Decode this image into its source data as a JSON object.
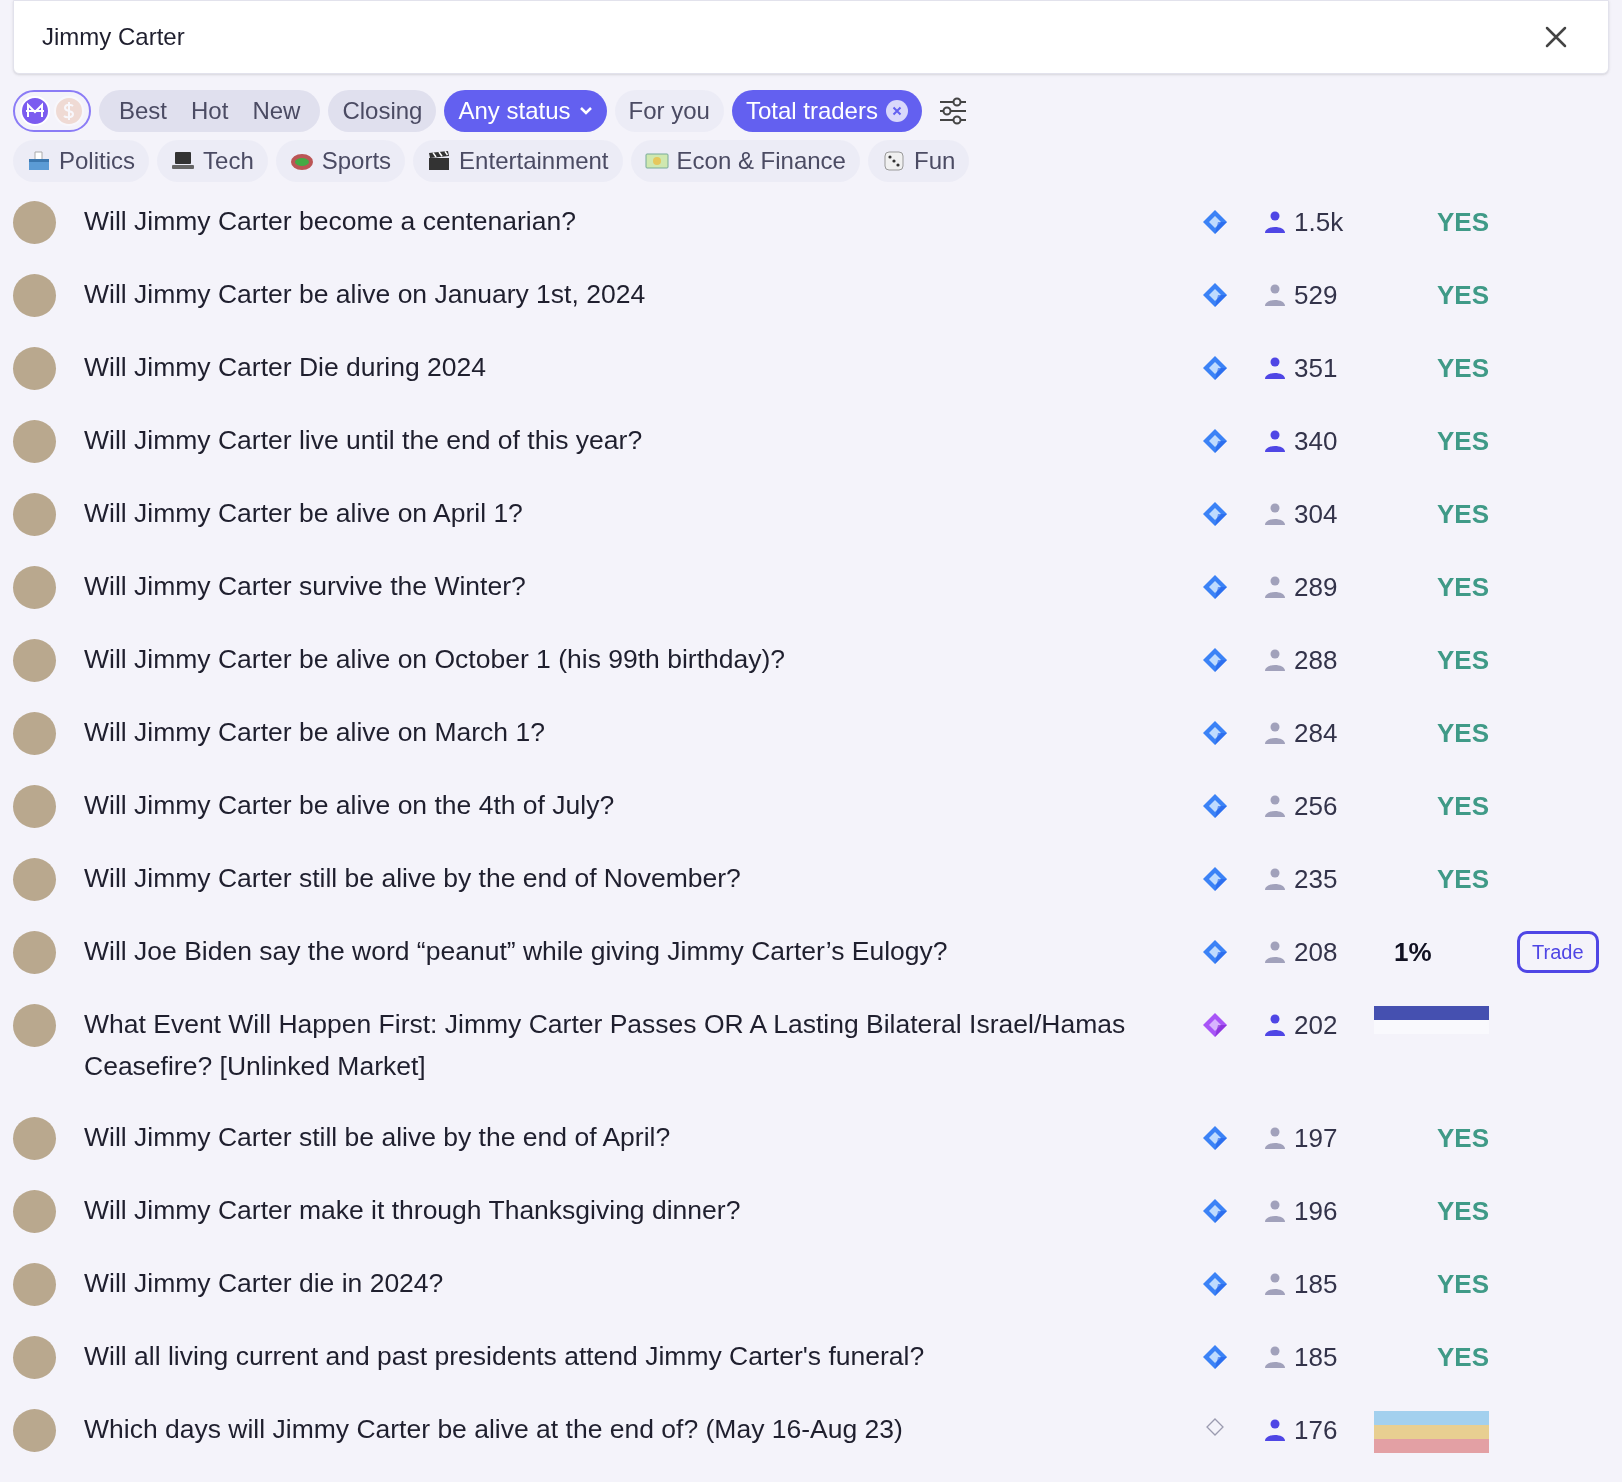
{
  "search": {
    "value": "Jimmy Carter"
  },
  "currency": [
    {
      "kind": "mana",
      "selected": true
    },
    {
      "kind": "cash",
      "selected": false
    }
  ],
  "filters": [
    {
      "kind": "group",
      "items": [
        "Best",
        "Hot",
        "New"
      ]
    },
    {
      "kind": "chip",
      "label": "Closing",
      "selected": false
    },
    {
      "kind": "dropdown",
      "label": "Any status",
      "selected": true
    },
    {
      "kind": "chip",
      "label": "For you",
      "selected": false
    },
    {
      "kind": "removable",
      "label": "Total traders",
      "selected": true
    }
  ],
  "topics": [
    {
      "kind": "ballot",
      "label": "Politics"
    },
    {
      "kind": "laptop",
      "label": "Tech"
    },
    {
      "kind": "stadium",
      "label": "Sports"
    },
    {
      "kind": "clapper",
      "label": "Entertainment"
    },
    {
      "kind": "money",
      "label": "Econ & Finance"
    },
    {
      "kind": "dice",
      "label": "Fun"
    }
  ],
  "markets": [
    {
      "question": "Will Jimmy Carter become a centenarian?",
      "badge": {
        "kind": "plus"
      },
      "traders_highlighted": true,
      "traders": "1.5k",
      "outcome": {
        "kind": "resolved",
        "text": "YES"
      }
    },
    {
      "question": "Will Jimmy Carter be alive on January 1st, 2024",
      "badge": {
        "kind": "plus"
      },
      "traders_highlighted": false,
      "traders": "529",
      "outcome": {
        "kind": "resolved",
        "text": "YES"
      }
    },
    {
      "question": "Will Jimmy Carter Die during 2024",
      "badge": {
        "kind": "plus"
      },
      "traders_highlighted": true,
      "traders": "351",
      "outcome": {
        "kind": "resolved",
        "text": "YES"
      }
    },
    {
      "question": "Will Jimmy Carter live until the end of this year?",
      "badge": {
        "kind": "plus"
      },
      "traders_highlighted": true,
      "traders": "340",
      "outcome": {
        "kind": "resolved",
        "text": "YES"
      }
    },
    {
      "question": "Will Jimmy Carter be alive on April 1?",
      "badge": {
        "kind": "plus"
      },
      "traders_highlighted": false,
      "traders": "304",
      "outcome": {
        "kind": "resolved",
        "text": "YES"
      }
    },
    {
      "question": "Will Jimmy Carter survive the Winter?",
      "badge": {
        "kind": "plus"
      },
      "traders_highlighted": false,
      "traders": "289",
      "outcome": {
        "kind": "resolved",
        "text": "YES"
      }
    },
    {
      "question": "Will Jimmy Carter be alive on October 1 (his 99th birthday)?",
      "badge": {
        "kind": "plus"
      },
      "traders_highlighted": false,
      "traders": "288",
      "outcome": {
        "kind": "resolved",
        "text": "YES"
      }
    },
    {
      "question": "Will Jimmy Carter be alive on March 1?",
      "badge": {
        "kind": "plus"
      },
      "traders_highlighted": false,
      "traders": "284",
      "outcome": {
        "kind": "resolved",
        "text": "YES"
      }
    },
    {
      "question": "Will Jimmy Carter be alive on the 4th of July?",
      "badge": {
        "kind": "plus"
      },
      "traders_highlighted": false,
      "traders": "256",
      "outcome": {
        "kind": "resolved",
        "text": "YES"
      }
    },
    {
      "question": "Will Jimmy Carter still be alive by the end of November?",
      "badge": {
        "kind": "plus"
      },
      "traders_highlighted": false,
      "traders": "235",
      "outcome": {
        "kind": "resolved",
        "text": "YES"
      }
    },
    {
      "question": "Will Joe Biden say the word “peanut” while giving Jimmy Carter’s Eulogy?",
      "badge": {
        "kind": "plus"
      },
      "traders_highlighted": false,
      "traders": "208",
      "outcome": {
        "kind": "probability",
        "text": "1%"
      },
      "trade_button": "Trade"
    },
    {
      "question": "What Event Will Happen First: Jimmy Carter Passes OR A Lasting Bilateral Israel/Hamas Ceasefire? [Unlinked Market]",
      "badge": {
        "kind": "premium"
      },
      "traders_highlighted": true,
      "traders": "202",
      "outcome": {
        "kind": "bars",
        "bars": [
          {
            "color": "#4550b0"
          },
          {
            "color": "#f9f9fd"
          }
        ]
      }
    },
    {
      "question": "Will Jimmy Carter still be alive by the end of April?",
      "badge": {
        "kind": "plus"
      },
      "traders_highlighted": false,
      "traders": "197",
      "outcome": {
        "kind": "resolved",
        "text": "YES"
      }
    },
    {
      "question": "Will Jimmy Carter make it through Thanksgiving dinner?",
      "badge": {
        "kind": "plus"
      },
      "traders_highlighted": false,
      "traders": "196",
      "outcome": {
        "kind": "resolved",
        "text": "YES"
      }
    },
    {
      "question": "Will Jimmy Carter die in 2024?",
      "badge": {
        "kind": "plus"
      },
      "traders_highlighted": false,
      "traders": "185",
      "outcome": {
        "kind": "resolved",
        "text": "YES"
      }
    },
    {
      "question": "Will all living current and past presidents attend Jimmy Carter's funeral?",
      "badge": {
        "kind": "plus"
      },
      "traders_highlighted": false,
      "traders": "185",
      "outcome": {
        "kind": "resolved",
        "text": "YES"
      }
    },
    {
      "question": "Which days will Jimmy Carter be alive at the end of? (May 16-Aug 23)",
      "badge": {
        "kind": "basic"
      },
      "traders_highlighted": true,
      "traders": "176",
      "outcome": {
        "kind": "bars",
        "bars": [
          {
            "color": "#a3d0ee"
          },
          {
            "color": "#e8cf91"
          },
          {
            "color": "#e3a0a4"
          }
        ]
      }
    }
  ]
}
